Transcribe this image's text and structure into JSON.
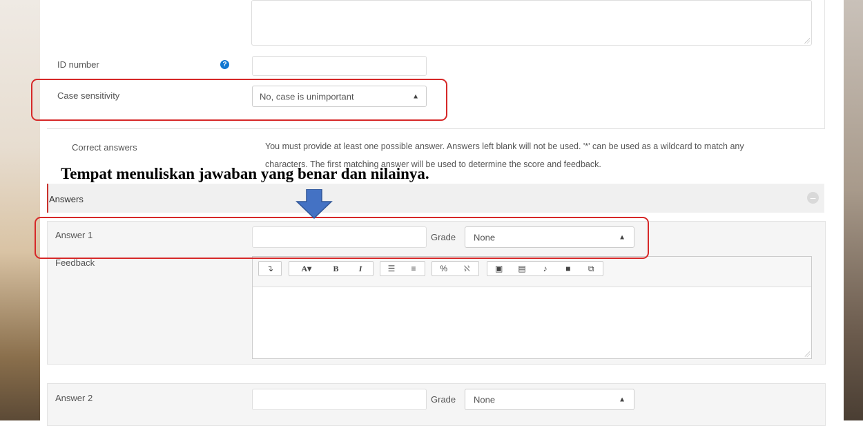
{
  "form": {
    "id_number": {
      "label": "ID number",
      "value": ""
    },
    "case_sensitivity": {
      "label": "Case sensitivity",
      "selected": "No, case is unimportant"
    },
    "correct_answers": {
      "label": "Correct answers",
      "help_line1": "You must provide at least one possible answer. Answers left blank will not be used. '*' can be used as a wildcard to match any",
      "help_line2": "characters. The first matching answer will be used to determine the score and feedback."
    },
    "answers_section": {
      "title": "Answers",
      "collapse_icon": "minus-icon"
    },
    "answer1": {
      "label": "Answer 1",
      "value": "",
      "grade_label": "Grade",
      "grade_selected": "None"
    },
    "feedback": {
      "label": "Feedback",
      "toolbar": {
        "show_more": "↴",
        "font_color": "A",
        "bold": "B",
        "italic": "I",
        "icons": [
          "show-more-icon",
          "font-color-icon",
          "bold-icon",
          "italic-icon",
          "unordered-list-icon",
          "ordered-list-icon",
          "link-icon",
          "unlink-icon",
          "insert-image-icon",
          "insert-media-icon",
          "record-audio-icon",
          "record-video-icon",
          "manage-files-icon"
        ]
      }
    },
    "answer2": {
      "label": "Answer 2",
      "value": "",
      "grade_label": "Grade",
      "grade_selected": "None"
    }
  },
  "annotation": {
    "text": "Tempat menuliskan jawaban yang benar dan nilainya.",
    "highlight_color": "#d62828",
    "arrow_color": "#4472c4"
  },
  "help_icon_color": "#1177d1",
  "required_bar_color": "#c9302c"
}
